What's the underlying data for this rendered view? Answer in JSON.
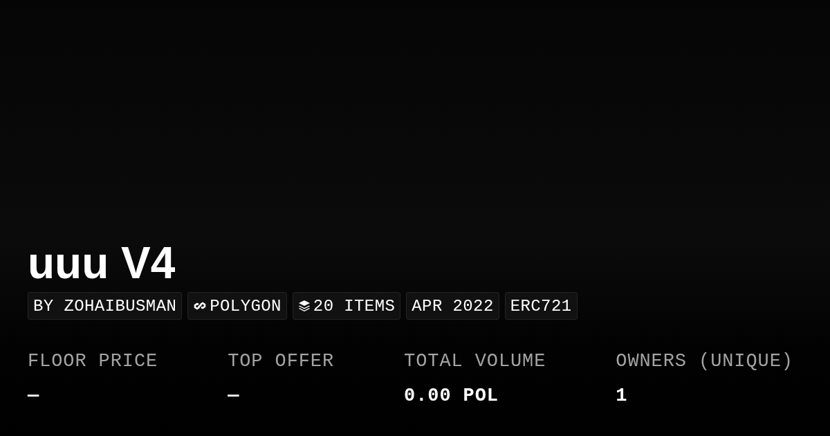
{
  "title": "uuu V4",
  "tags": [
    {
      "kind": "text",
      "label": "BY ZOHAIBUSMAN"
    },
    {
      "kind": "chain",
      "label": "POLYGON"
    },
    {
      "kind": "items",
      "label": "20 ITEMS"
    },
    {
      "kind": "text",
      "label": "APR 2022"
    },
    {
      "kind": "text",
      "label": "ERC721"
    }
  ],
  "stats": [
    {
      "label": "FLOOR PRICE",
      "value": "—"
    },
    {
      "label": "TOP OFFER",
      "value": "—"
    },
    {
      "label": "TOTAL VOLUME",
      "value": "0.00 POL"
    },
    {
      "label": "OWNERS (UNIQUE)",
      "value": "1"
    }
  ]
}
